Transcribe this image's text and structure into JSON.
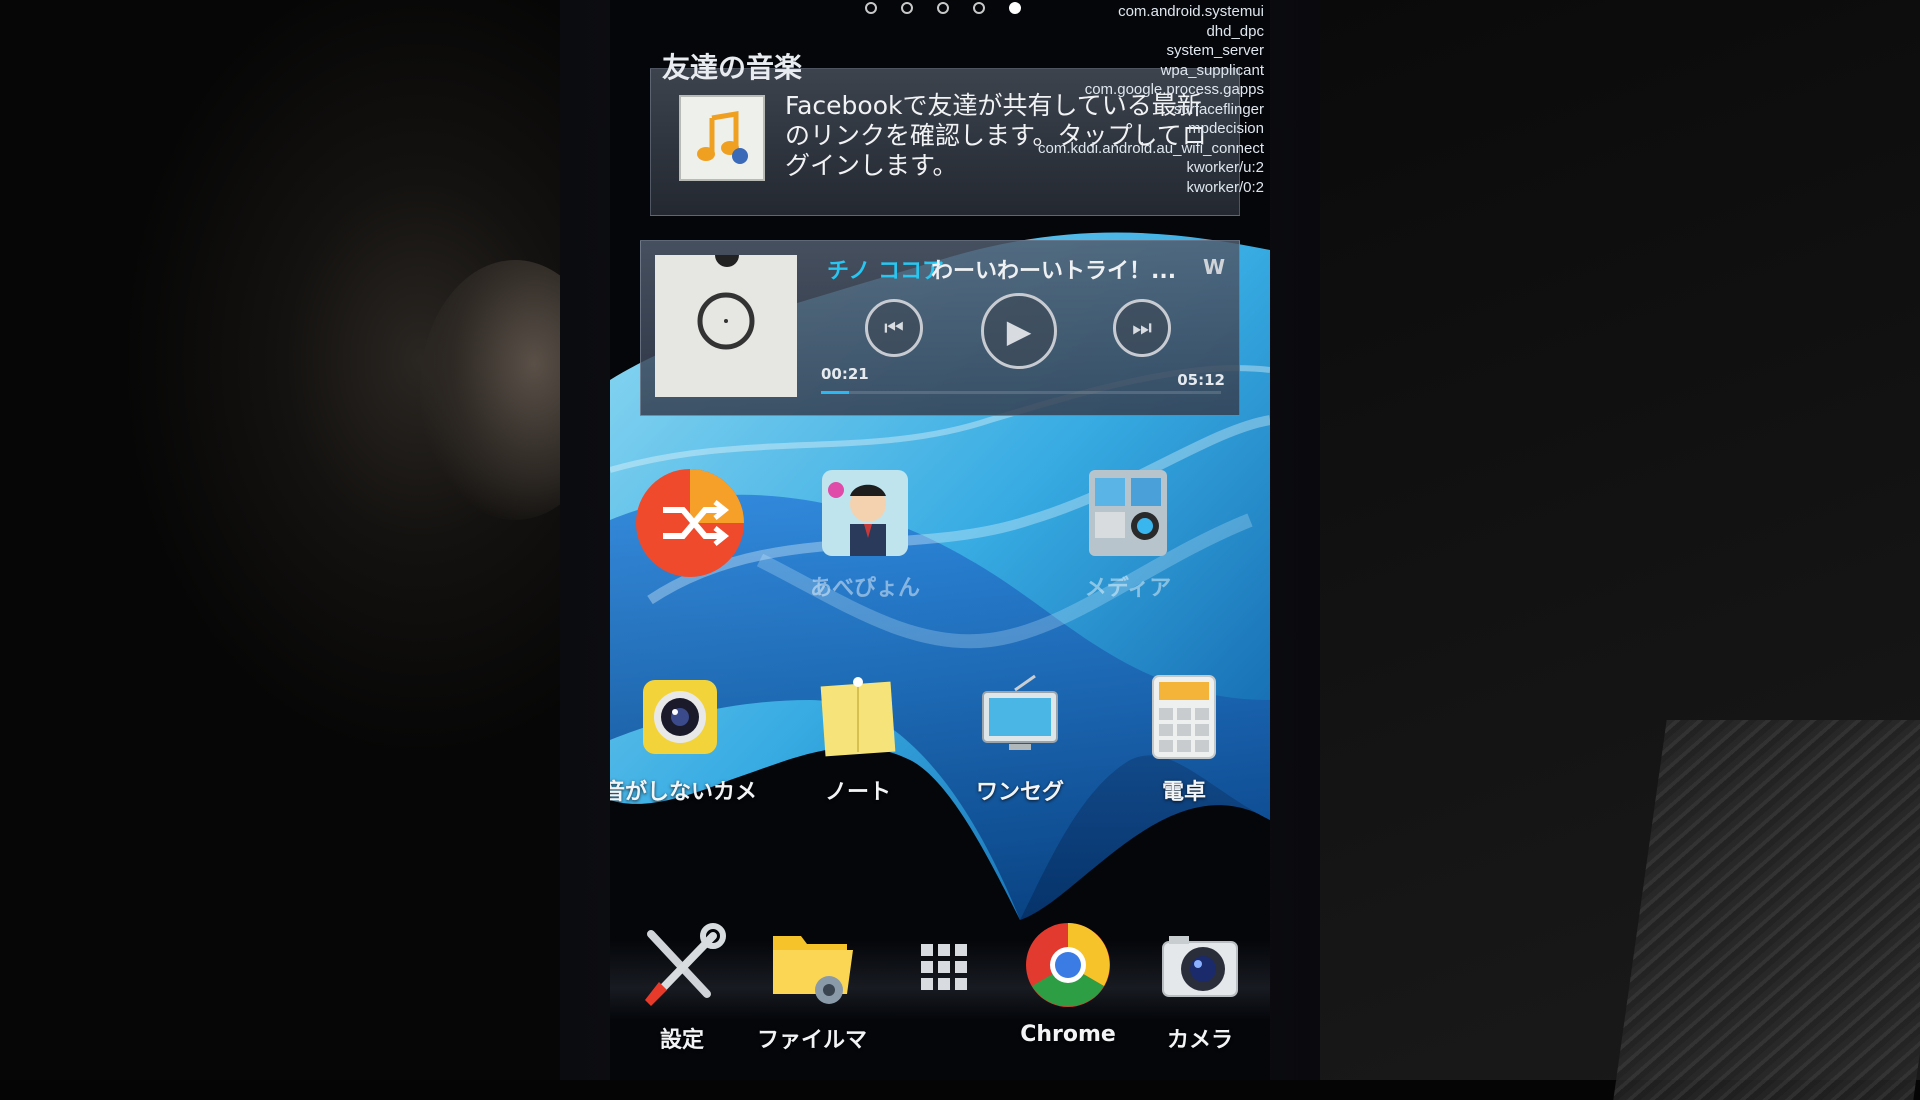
{
  "page_indicator": {
    "total": 5,
    "active": 4
  },
  "process_overlay": [
    "com.android.systemui",
    "dhd_dpc",
    "system_server",
    "wpa_supplicant",
    "com.google.process.gapps",
    "surfaceflinger",
    "mpdecision",
    "com.kddi.android.au_wifi_connect",
    "kworker/u:2",
    "kworker/0:2"
  ],
  "friends_music": {
    "title": "友達の音楽",
    "message": "Facebookで友達が共有している最新のリンクを確認します。タップしてログインします。"
  },
  "music_player": {
    "artist": "チノ ココア",
    "track": "わーいわーいトライ！...",
    "elapsed": "00:21",
    "total": "05:12",
    "progress": 0.07,
    "logo": "W"
  },
  "apps_row1": [
    {
      "name": "shuffle-app",
      "label": "",
      "icon": "shuffle-icon"
    },
    {
      "name": "abepyon-app",
      "label": "あべぴょん",
      "icon": "character-icon"
    },
    {
      "name": "media-app",
      "label": "メディア",
      "icon": "media-folder-icon"
    }
  ],
  "apps_row2": [
    {
      "name": "silent-camera-app",
      "label": "音がしないカメ",
      "icon": "camera-lens-icon"
    },
    {
      "name": "note-app",
      "label": "ノート",
      "icon": "sticky-note-icon"
    },
    {
      "name": "oneseg-app",
      "label": "ワンセグ",
      "icon": "tv-icon"
    },
    {
      "name": "calculator-app",
      "label": "電卓",
      "icon": "calculator-icon"
    }
  ],
  "dock": [
    {
      "name": "settings-app",
      "label": "設定",
      "icon": "tools-icon"
    },
    {
      "name": "file-manager-app",
      "label": "ファイルマ",
      "icon": "folder-gear-icon"
    },
    {
      "name": "app-drawer",
      "label": "",
      "icon": "grid-icon"
    },
    {
      "name": "chrome-app",
      "label": "Chrome",
      "icon": "chrome-icon"
    },
    {
      "name": "camera-app",
      "label": "カメラ",
      "icon": "camera-icon"
    }
  ],
  "colors": {
    "accent": "#28c6f0",
    "shuffle": "#e8462e"
  }
}
